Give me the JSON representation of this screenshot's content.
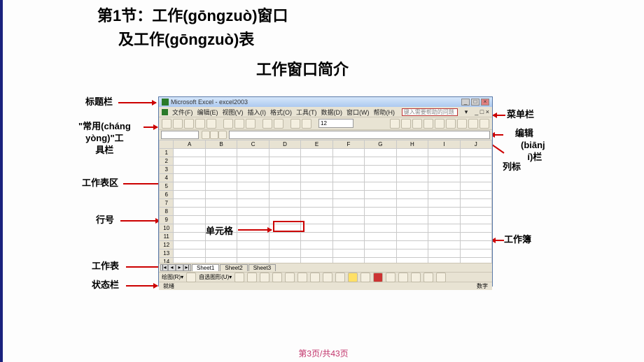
{
  "title": {
    "line1": "第1节：工作(gōngzuò)窗口",
    "line2": "及工作(gōngzuò)表",
    "subtitle": "工作窗口简介"
  },
  "labels": {
    "titlebar": "标题栏",
    "menubar": "菜单栏",
    "common_toolbar_l1": "\"常用(cháng",
    "common_toolbar_l2": "yòng)\"工",
    "common_toolbar_l3": "具栏",
    "editbar_l1": "编辑",
    "editbar_l2": "(biānj",
    "editbar_l3": "í)栏",
    "column_header": "列标",
    "worksheet_area": "工作表区",
    "row_number": "行号",
    "cell": "单元格",
    "worksheet": "工作表",
    "statusbar": "状态栏",
    "workbook": "工作簿"
  },
  "excel": {
    "app_title": "Microsoft Excel - excel2003",
    "menus": [
      "文件(F)",
      "编辑(E)",
      "视图(V)",
      "插入(I)",
      "格式(O)",
      "工具(T)",
      "数据(D)",
      "窗口(W)",
      "帮助(H)"
    ],
    "help_placeholder": "键入需要帮助的问题",
    "font_size": "12",
    "columns": [
      "A",
      "B",
      "C",
      "D",
      "E",
      "F",
      "G",
      "H",
      "I",
      "J"
    ],
    "row_count": 15,
    "sheet_tabs": [
      "Sheet1",
      "Sheet2",
      "Sheet3"
    ],
    "draw_label": "绘图(R)▾",
    "autoshape_label": "自选图形(U)▾",
    "status_left": "就绪",
    "status_right": "数字"
  },
  "footer": "第3页/共43页"
}
